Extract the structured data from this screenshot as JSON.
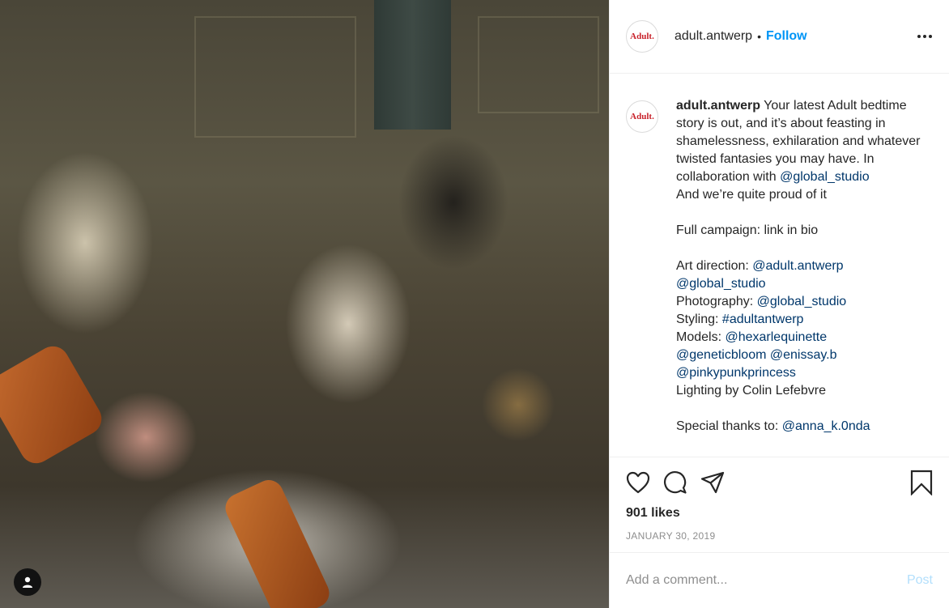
{
  "post": {
    "photo_alt": "",
    "user_tag_icon": "person-icon"
  },
  "header": {
    "avatar_text": "Adult.",
    "username": "adult.antwerp",
    "separator": "•",
    "follow_label": "Follow",
    "more_icon": "more-horizontal-icon"
  },
  "caption": {
    "avatar_text": "Adult.",
    "username": "adult.antwerp",
    "lines": [
      {
        "text": "Your latest Adult bedtime story is out, and it’s about feasting in shamelessness, exhilaration and whatever twisted fantasies you may have. In collaboration with"
      },
      {
        "tag": "@global_studio"
      },
      {
        "text": "And we’re quite proud of it"
      },
      {
        "text": "Full campaign: link in bio"
      },
      {
        "prefix": "Art direction: ",
        "tag": "@adult.antwerp"
      },
      {
        "tag": "@global_studio"
      },
      {
        "prefix": "Photography: ",
        "tag": "@global_studio"
      },
      {
        "prefix": "Styling: ",
        "tag": "#adultantwerp"
      },
      {
        "prefix": "Models: ",
        "tag": "@hexarlequinette"
      },
      {
        "tag": "@geneticbloom",
        "tag2": "@enissay.b"
      },
      {
        "tag": "@pinkypunkprincess"
      },
      {
        "text": "Lighting by Colin Lefebvre"
      },
      {
        "prefix": "Special thanks to: ",
        "tag": "@anna_k.0nda"
      }
    ]
  },
  "actions": {
    "like_icon": "heart-icon",
    "comment_icon": "comment-icon",
    "share_icon": "share-icon",
    "save_icon": "bookmark-icon",
    "likes": "901 likes",
    "date": "JANUARY 30, 2019"
  },
  "add_comment": {
    "placeholder": "Add a comment...",
    "post_label": "Post"
  },
  "colors": {
    "follow": "#0095f6",
    "tag": "#00376b",
    "post_disabled": "#b2dffc",
    "brand_red": "#c8222b"
  }
}
